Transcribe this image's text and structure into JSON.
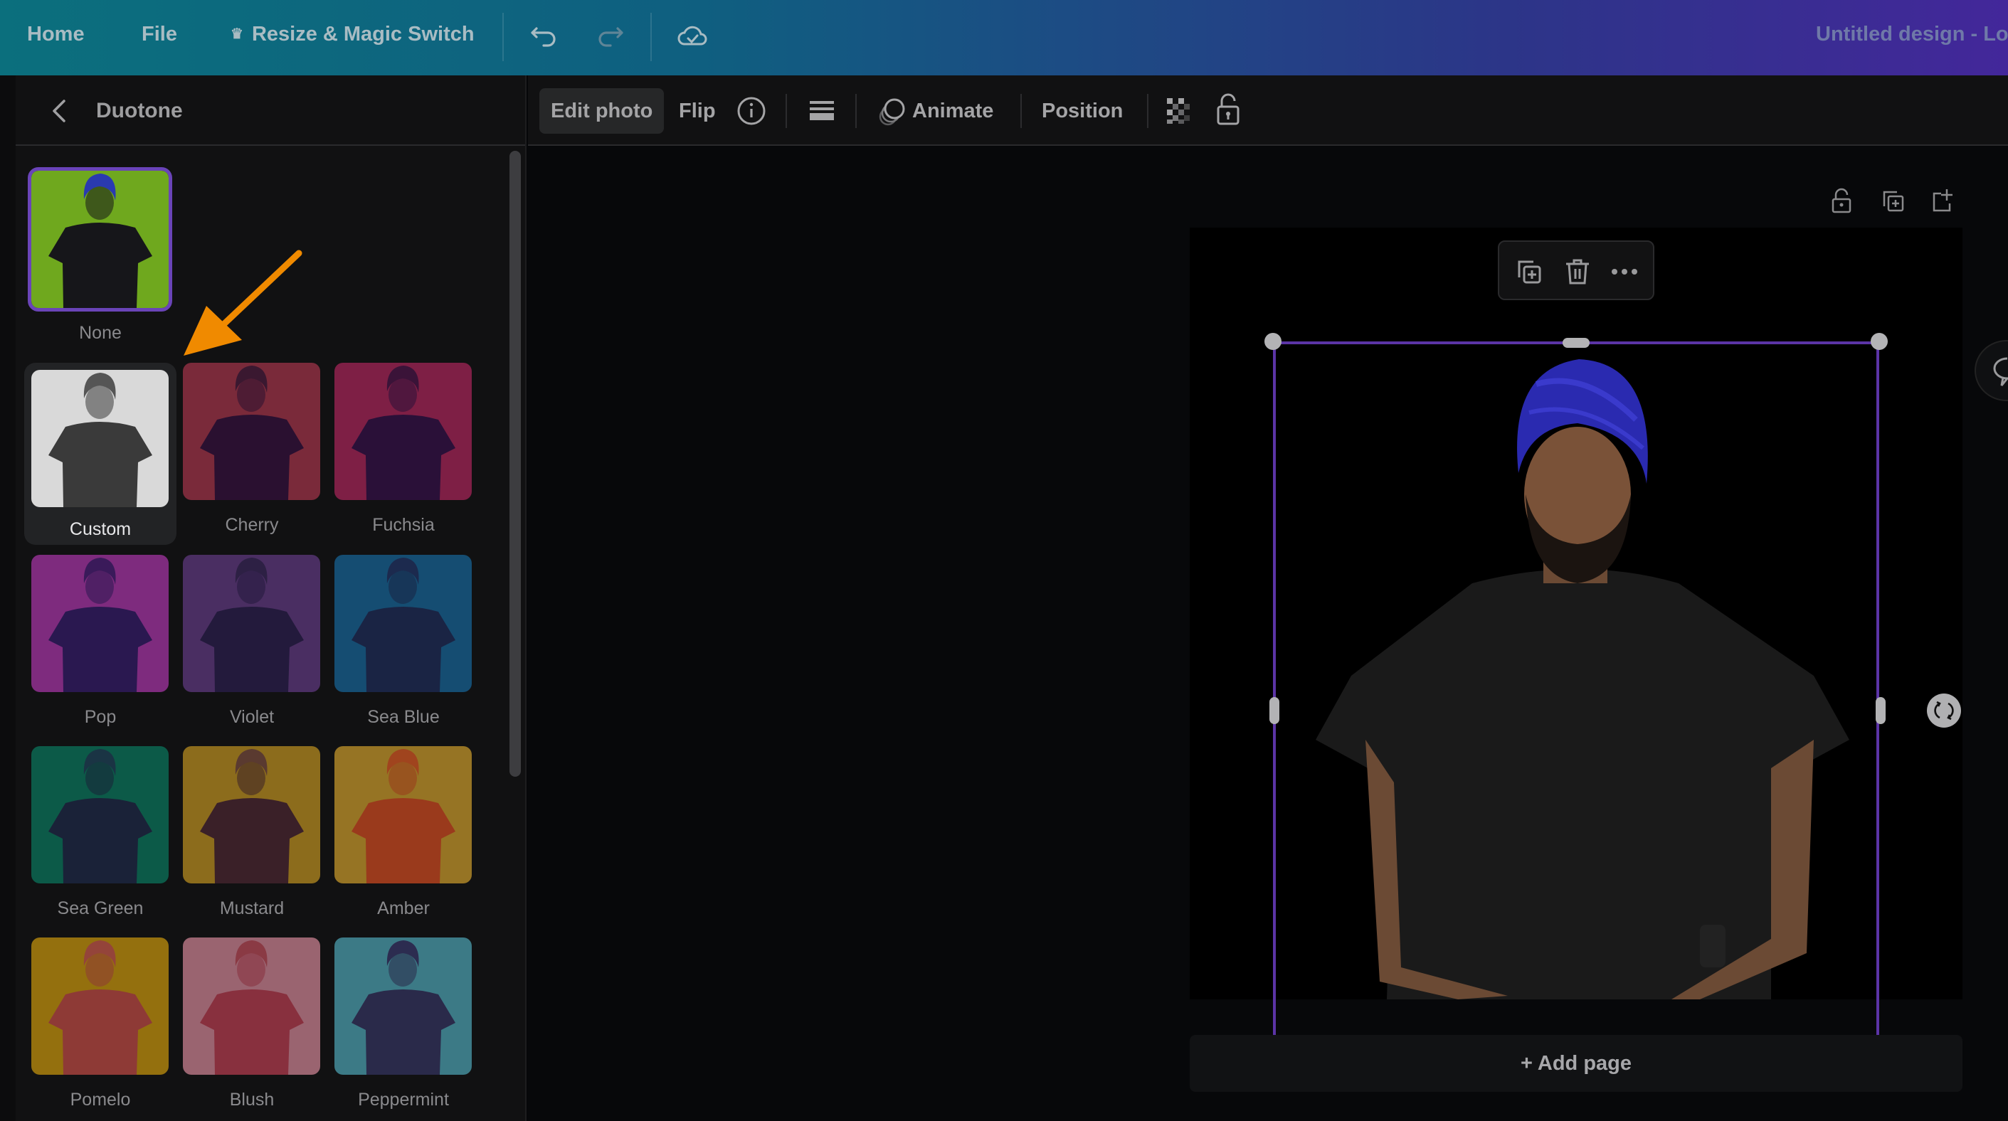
{
  "topbar": {
    "home": "Home",
    "file": "File",
    "resize": "Resize & Magic Switch",
    "resize_icon": "crown-icon",
    "undo_icon": "undo-icon",
    "redo_icon": "redo-icon",
    "cloud_icon": "cloud-saved-icon",
    "title": "Untitled design - Lo"
  },
  "sidebar": {
    "back_icon": "chevron-left-icon",
    "title": "Duotone",
    "selected": "None",
    "hovered": "Custom",
    "filters": [
      {
        "label": "None",
        "bg": "#6fa81e",
        "fg": "#16161a",
        "turban": "#2a3ab0"
      },
      {
        "label": "Custom",
        "bg": "#d9d9d9",
        "fg": "#3a3a3a",
        "turban": "#555555"
      },
      {
        "label": "Cherry",
        "bg": "#7a2a3a",
        "fg": "#2a1030",
        "turban": "#3a1830"
      },
      {
        "label": "Fuchsia",
        "bg": "#7e1f45",
        "fg": "#2a1038",
        "turban": "#3a1338"
      },
      {
        "label": "Pop",
        "bg": "#7e2b7e",
        "fg": "#2a1850",
        "turban": "#3a1a5a"
      },
      {
        "label": "Violet",
        "bg": "#4a2e62",
        "fg": "#231a3c",
        "turban": "#2d2044"
      },
      {
        "label": "Sea Blue",
        "bg": "#154d72",
        "fg": "#1a2444",
        "turban": "#1c2a4e"
      },
      {
        "label": "Sea Green",
        "bg": "#0c5a48",
        "fg": "#1a2238",
        "turban": "#1a3444"
      },
      {
        "label": "Mustard",
        "bg": "#8c6c1c",
        "fg": "#3a2028",
        "turban": "#5a3a30"
      },
      {
        "label": "Amber",
        "bg": "#967424",
        "fg": "#9a3a1c",
        "turban": "#a0441e"
      },
      {
        "label": "Pomelo",
        "bg": "#94700e",
        "fg": "#8e3a36",
        "turban": "#94443a"
      },
      {
        "label": "Blush",
        "bg": "#9a6470",
        "fg": "#88303e",
        "turban": "#8a3a44"
      },
      {
        "label": "Peppermint",
        "bg": "#3c7a86",
        "fg": "#2a2a4a",
        "turban": "#2c2c50"
      }
    ]
  },
  "toolbar": {
    "edit_photo": "Edit photo",
    "flip": "Flip",
    "info_icon": "info-icon",
    "menu_icon": "lines-icon",
    "animate_icon": "animate-icon",
    "animate": "Animate",
    "position": "Position",
    "transparency_icon": "transparency-icon",
    "lock_icon": "unlock-icon"
  },
  "canvas": {
    "page_lock_icon": "unlock-icon",
    "page_duplicate_icon": "duplicate-icon",
    "page_add_icon": "add-page-icon",
    "float_duplicate_icon": "duplicate-icon",
    "float_delete_icon": "trash-icon",
    "float_more_icon": "more-icon",
    "rotate_icon": "rotate-icon",
    "add_page": "+ Add page",
    "selection_color": "#5b34a6"
  },
  "colors": {
    "accent": "#6a44b8",
    "annotation_arrow": "#f08a00"
  }
}
